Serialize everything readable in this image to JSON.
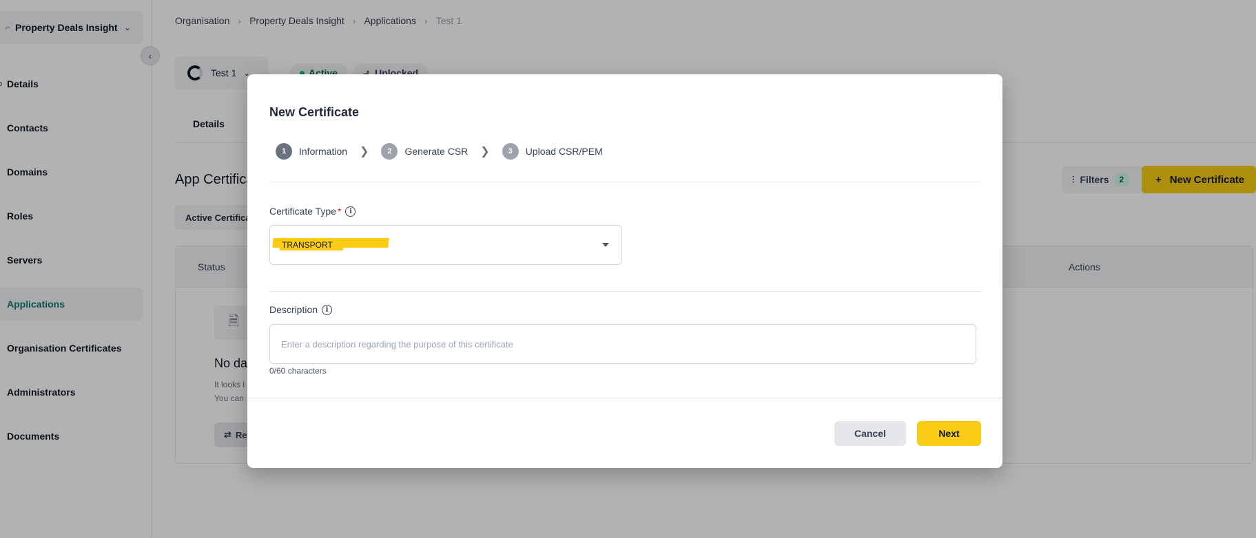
{
  "sidebar": {
    "org_name": "Property Deals Insight",
    "items": [
      {
        "label": "Details"
      },
      {
        "label": "Contacts"
      },
      {
        "label": "Domains"
      },
      {
        "label": "Roles"
      },
      {
        "label": "Servers"
      },
      {
        "label": "Applications"
      },
      {
        "label": "Organisation Certificates"
      },
      {
        "label": "Administrators"
      },
      {
        "label": "Documents"
      }
    ],
    "active_item": "Applications"
  },
  "breadcrumb": [
    "Organisation",
    "Property Deals Insight",
    "Applications",
    "Test 1"
  ],
  "app": {
    "name": "Test 1",
    "status": "Active",
    "lock_state": "Unlocked",
    "tab": "Details",
    "section_title": "App Certifica",
    "sub_tab": "Active Certifica",
    "filters_label": "Filters",
    "filters_count": "2",
    "new_certificate_label": "New Certificate",
    "table_columns": {
      "status": "Status",
      "actions": "Actions"
    },
    "empty_title": "No dat",
    "empty_line1": "It looks l",
    "empty_line2": "You can",
    "retry_label": "Re"
  },
  "modal": {
    "title": "New Certificate",
    "steps": [
      {
        "num": "1",
        "label": "Information"
      },
      {
        "num": "2",
        "label": "Generate CSR"
      },
      {
        "num": "3",
        "label": "Upload CSR/PEM"
      }
    ],
    "certificate_type": {
      "label": "Certificate Type",
      "required_mark": "*",
      "value": "TRANSPORT"
    },
    "description": {
      "label": "Description",
      "placeholder": "Enter a description regarding the purpose of this certificate",
      "value": "",
      "char_count": "0/60 characters"
    },
    "cancel_label": "Cancel",
    "next_label": "Next"
  },
  "colors": {
    "accent": "#facc15",
    "active_nav": "#0f766e",
    "status_active": "#10b981"
  },
  "icons": {
    "info": "info-circle-icon",
    "step_separator": "chevron-right-icon",
    "select": "caret-down-icon"
  }
}
